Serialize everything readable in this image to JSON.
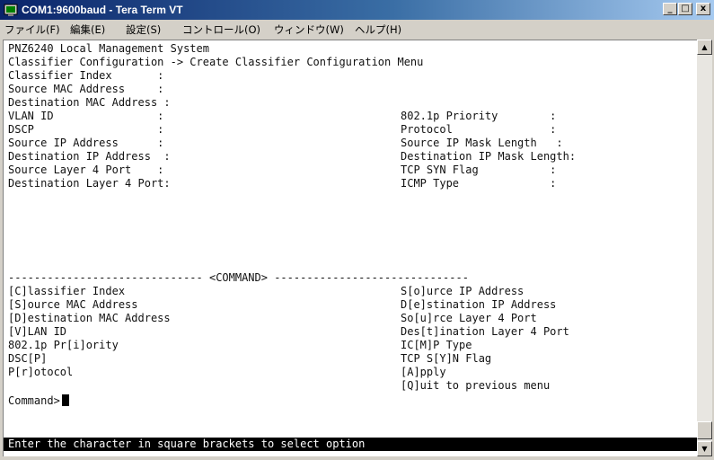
{
  "window": {
    "title": "COM1:9600baud - Tera Term VT",
    "minimize": "_",
    "maximize": "□",
    "close": "x"
  },
  "menu": [
    "ファイル(F)",
    "編集(E)",
    "設定(S)",
    "コントロール(O)",
    "ウィンドウ(W)",
    "ヘルプ(H)"
  ],
  "terminal": {
    "header": [
      "PNZ6240 Local Management System",
      "Classifier Configuration -> Create Classifier Configuration Menu"
    ],
    "fields_single": [
      "Classifier Index       :",
      "Source MAC Address     :",
      "Destination MAC Address :"
    ],
    "fields_left": [
      "VLAN ID                :",
      "DSCP                   :",
      "Source IP Address      :",
      "Destination IP Address  :",
      "Source Layer 4 Port    :",
      "Destination Layer 4 Port:"
    ],
    "fields_right": [
      "802.1p Priority        :",
      "Protocol               :",
      "Source IP Mask Length   :",
      "Destination IP Mask Length:",
      "TCP SYN Flag           :",
      "ICMP Type              :"
    ],
    "divider": "------------------------------ <COMMAND> ------------------------------",
    "commands_left": [
      "[C]lassifier Index",
      "[S]ource MAC Address",
      "[D]estination MAC Address",
      "[V]LAN ID",
      "802.1p Pr[i]ority",
      "DSC[P]",
      "P[r]otocol"
    ],
    "commands_right": [
      "S[o]urce IP Address",
      "D[e]stination IP Address",
      "So[u]rce Layer 4 Port",
      "Des[t]ination Layer 4 Port",
      "IC[M]P Type",
      "TCP S[Y]N Flag",
      "[A]pply",
      "[Q]uit to previous menu"
    ],
    "prompt": "Command>",
    "status": "Enter the character in square brackets to select option"
  },
  "scrollbar": {
    "up_arrow": "▲",
    "down_arrow": "▼"
  }
}
